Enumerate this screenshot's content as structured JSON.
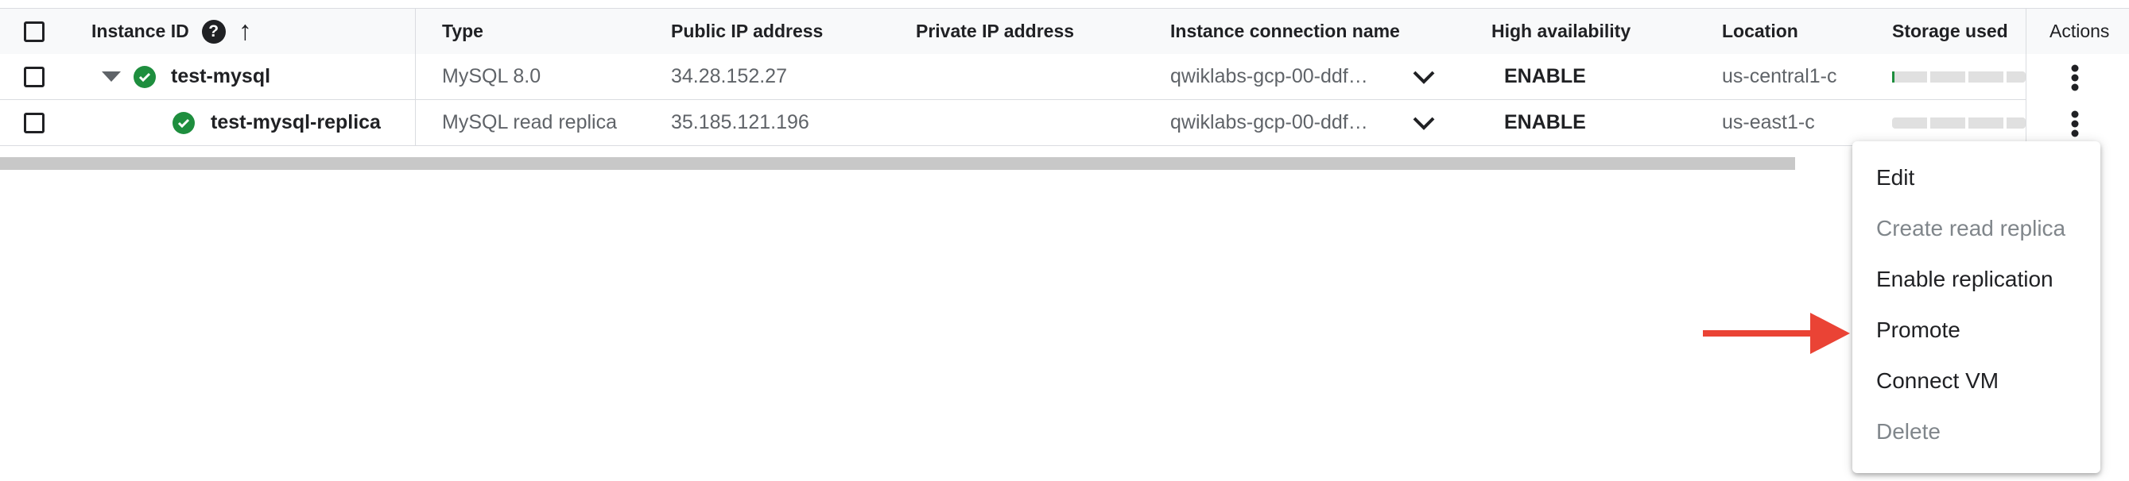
{
  "header": {
    "instance_id": "Instance ID",
    "type": "Type",
    "public_ip": "Public IP address",
    "private_ip": "Private IP address",
    "connection_name": "Instance connection name",
    "high_availability": "High availability",
    "location": "Location",
    "storage_used": "Storage used",
    "actions": "Actions"
  },
  "rows": [
    {
      "name": "test-mysql",
      "type": "MySQL 8.0",
      "public_ip": "34.28.152.27",
      "private_ip": "",
      "connection": "qwiklabs-gcp-00-ddf…",
      "ha": "ENABLE",
      "location": "us-central1-c",
      "storage_fraction": 0.02
    },
    {
      "name": "test-mysql-replica",
      "type": "MySQL read replica",
      "public_ip": "35.185.121.196",
      "private_ip": "",
      "connection": "qwiklabs-gcp-00-ddf…",
      "ha": "ENABLE",
      "location": "us-east1-c",
      "storage_fraction": 0.0
    }
  ],
  "menu": {
    "items": [
      {
        "label": "Edit",
        "disabled": false
      },
      {
        "label": "Create read replica",
        "disabled": true
      },
      {
        "label": "Enable replication",
        "disabled": false
      },
      {
        "label": "Promote",
        "disabled": false
      },
      {
        "label": "Connect VM",
        "disabled": false
      },
      {
        "label": "Delete",
        "disabled": true
      }
    ]
  },
  "colors": {
    "status_ok": "#1e8e3e",
    "arrow": "#ea4335",
    "storage_bar": "#e0e0e0",
    "storage_fill": "#1e8e3e"
  },
  "icons": {
    "help": "help-icon",
    "sort": "arrow-up-icon",
    "expand": "caret-down-icon",
    "status": "check-circle-icon",
    "more": "more-vert-icon",
    "chevron": "chevron-down-icon"
  }
}
